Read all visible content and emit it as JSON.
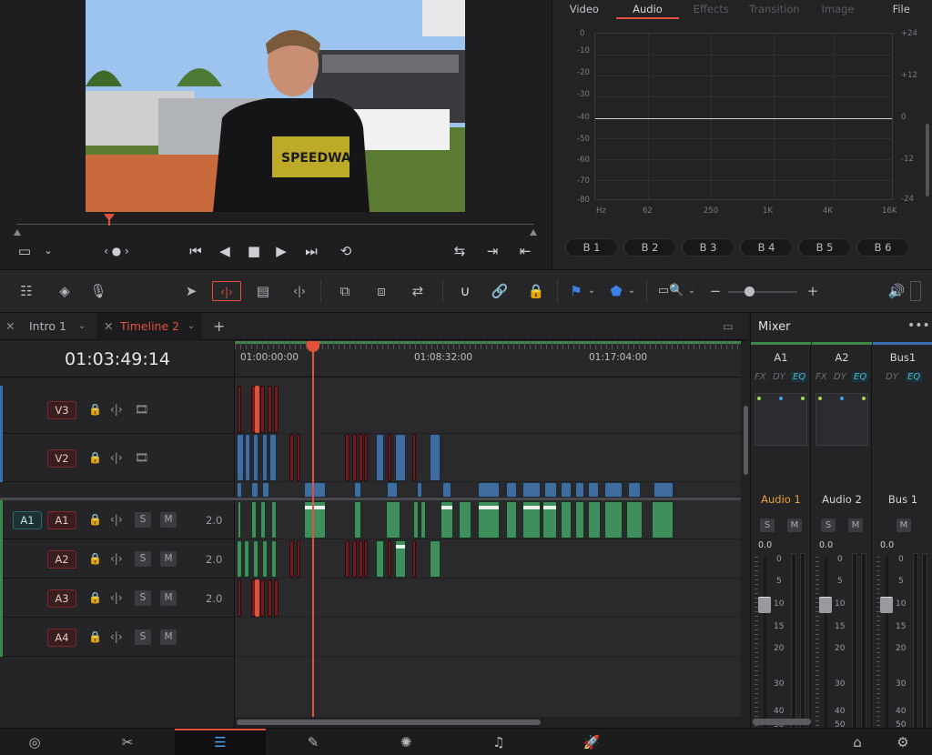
{
  "inspector": {
    "tabs": [
      "Video",
      "Audio",
      "Effects",
      "Transition",
      "Image",
      "File"
    ],
    "active_tab": "Audio",
    "eq_left_scale": [
      "0",
      "-10",
      "-20",
      "-30",
      "-40",
      "-50",
      "-60",
      "-70",
      "-80"
    ],
    "eq_right_scale": [
      "+24",
      "+12",
      "0",
      "-12",
      "-24"
    ],
    "eq_x_scale": [
      "Hz",
      "62",
      "250",
      "1K",
      "4K",
      "16K"
    ],
    "bands": [
      "B 1",
      "B 2",
      "B 3",
      "B 4",
      "B 5",
      "B 6"
    ]
  },
  "timeline": {
    "tabs": [
      {
        "label": "Intro 1",
        "active": false
      },
      {
        "label": "Timeline 2",
        "active": true
      }
    ],
    "timecode": "01:03:49:14",
    "ruler_labels": [
      "01:00:00:00",
      "01:08:32:00",
      "01:17:04:00"
    ],
    "video_tracks": [
      "V3",
      "V2"
    ],
    "audio_tracks": [
      {
        "name": "A1",
        "patch": "A1",
        "volume": "2.0"
      },
      {
        "name": "A2",
        "volume": "2.0"
      },
      {
        "name": "A3",
        "volume": "2.0"
      },
      {
        "name": "A4",
        "volume": ""
      }
    ],
    "solo_label": "S",
    "mute_label": "M"
  },
  "mixer": {
    "title": "Mixer",
    "columns": [
      {
        "name": "A1",
        "fx": [
          "FX",
          "DY",
          "EQ"
        ],
        "track": "Audio 1",
        "track_color": "#e8a23c",
        "value": "0.0",
        "head_color": "#3c8a4a"
      },
      {
        "name": "A2",
        "fx": [
          "FX",
          "DY",
          "EQ"
        ],
        "track": "Audio 2",
        "track_color": "#d4d4d6",
        "value": "0.0",
        "head_color": "#3c8a4a"
      },
      {
        "name": "Bus1",
        "fx": [
          "DY",
          "EQ"
        ],
        "track": "Bus 1",
        "track_color": "#d4d4d6",
        "value": "0.0",
        "head_color": "#3b6fb0"
      }
    ],
    "fader_scale": [
      "0",
      "5",
      "10",
      "15",
      "20",
      "30",
      "40",
      "50"
    ],
    "solo_label": "S",
    "mute_label": "M"
  },
  "icons": {
    "transport": [
      "jump-to-start-icon",
      "reverse-play-icon",
      "stop-icon",
      "play-icon",
      "jump-to-end-icon",
      "loop-icon"
    ],
    "pages": [
      "media-icon",
      "cut-icon",
      "edit-icon",
      "fusion-icon",
      "color-icon",
      "fairlight-icon",
      "deliver-icon"
    ]
  },
  "colors": {
    "accent": "#e2513b",
    "video_clip": "#3f6d9f",
    "audio_clip": "#3f8f5c",
    "disabled_clip": "#6b1d20"
  }
}
